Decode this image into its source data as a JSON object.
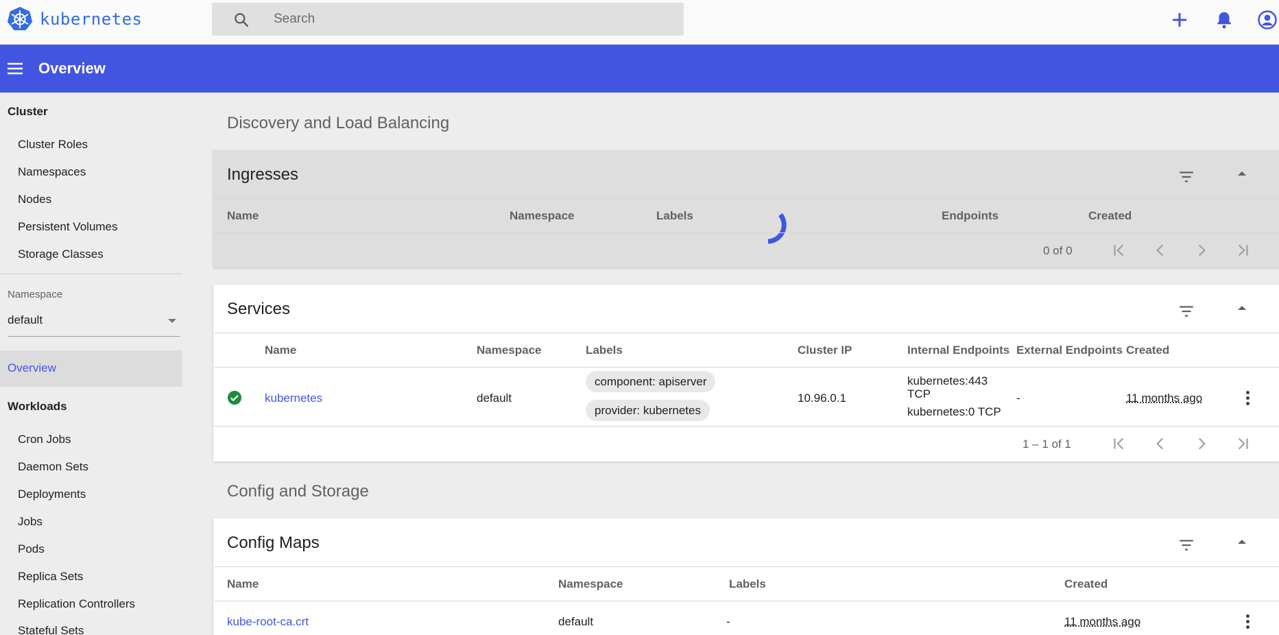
{
  "app": {
    "name": "kubernetes"
  },
  "search": {
    "placeholder": "Search"
  },
  "header": {
    "title": "Overview"
  },
  "sidebar": {
    "cluster_heading": "Cluster",
    "cluster_items": [
      "Cluster Roles",
      "Namespaces",
      "Nodes",
      "Persistent Volumes",
      "Storage Classes"
    ],
    "namespace_label": "Namespace",
    "namespace_value": "default",
    "active_item": "Overview",
    "workloads_heading": "Workloads",
    "workload_items": [
      "Cron Jobs",
      "Daemon Sets",
      "Deployments",
      "Jobs",
      "Pods",
      "Replica Sets",
      "Replication Controllers",
      "Stateful Sets"
    ]
  },
  "discovery": {
    "section_title": "Discovery and Load Balancing",
    "ingresses": {
      "title": "Ingresses",
      "columns": [
        "Name",
        "Namespace",
        "Labels",
        "Endpoints",
        "Created"
      ],
      "pager": "0 of 0"
    },
    "services": {
      "title": "Services",
      "columns": [
        "Name",
        "Namespace",
        "Labels",
        "Cluster IP",
        "Internal Endpoints",
        "External Endpoints",
        "Created"
      ],
      "rows": [
        {
          "status": "ok",
          "name": "kubernetes",
          "namespace": "default",
          "labels": [
            "component: apiserver",
            "provider: kubernetes"
          ],
          "cluster_ip": "10.96.0.1",
          "internal_endpoints": [
            "kubernetes:443",
            "TCP",
            "kubernetes:0 TCP"
          ],
          "external_endpoints": "-",
          "created": "11 months ago"
        }
      ],
      "pager": "1 – 1 of 1"
    }
  },
  "config": {
    "section_title": "Config and Storage",
    "config_maps": {
      "title": "Config Maps",
      "columns": [
        "Name",
        "Namespace",
        "Labels",
        "Created"
      ],
      "rows": [
        {
          "name": "kube-root-ca.crt",
          "namespace": "default",
          "labels": "-",
          "created": "11 months ago"
        }
      ]
    }
  },
  "colors": {
    "brand_blue": "#326ce5",
    "header_blue": "#4255e0",
    "status_ok": "#1e8e3e"
  }
}
